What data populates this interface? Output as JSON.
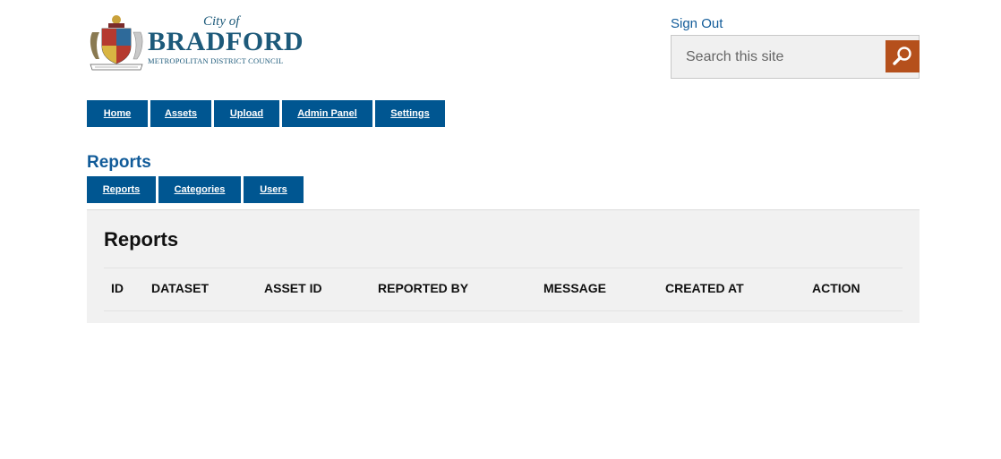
{
  "header": {
    "logo": {
      "city_of": "City of",
      "name": "BRADFORD",
      "subtitle": "METROPOLITAN DISTRICT COUNCIL"
    },
    "sign_out_label": "Sign Out",
    "search": {
      "placeholder": "Search this site",
      "value": "",
      "button_color": "#b5501c",
      "button_icon": "magnifier-icon"
    }
  },
  "nav": {
    "color": "#005691",
    "items": [
      {
        "label": "Home"
      },
      {
        "label": "Assets"
      },
      {
        "label": "Upload"
      },
      {
        "label": "Admin Panel"
      },
      {
        "label": "Settings"
      }
    ]
  },
  "section": {
    "title": "Reports",
    "subnav": [
      {
        "label": "Reports"
      },
      {
        "label": "Categories"
      },
      {
        "label": "Users"
      }
    ]
  },
  "panel": {
    "title": "Reports",
    "table": {
      "columns": [
        "ID",
        "DATASET",
        "ASSET ID",
        "REPORTED BY",
        "MESSAGE",
        "CREATED AT",
        "ACTION"
      ],
      "rows": []
    }
  }
}
